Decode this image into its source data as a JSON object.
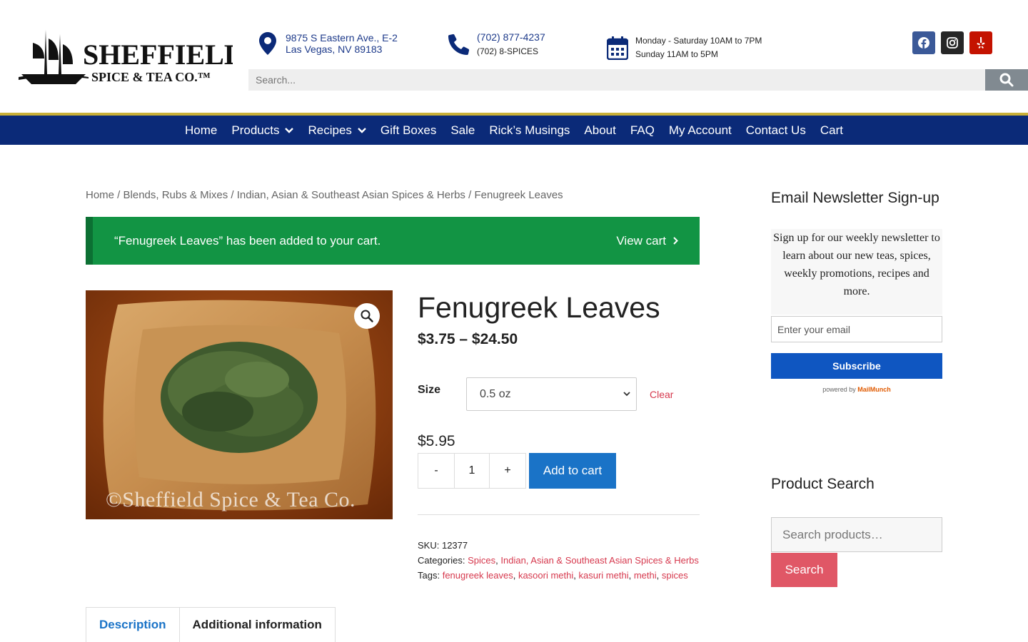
{
  "header": {
    "logo_text": "Sheffield Spice & Tea Co.",
    "address_line1": "9875 S Eastern Ave., E-2",
    "address_line2": "Las Vegas, NV 89183",
    "phone_line1": "(702) 877-4237",
    "phone_line2": "(702) 8-SPICES",
    "hours_line1": "Monday - Saturday 10AM to 7PM",
    "hours_line2": "Sunday 11AM to 5PM",
    "socials": [
      {
        "name": "facebook-icon",
        "color": "#3b5998"
      },
      {
        "name": "instagram-icon",
        "color": "#262626"
      },
      {
        "name": "yelp-icon",
        "color": "#c41200"
      }
    ],
    "search_placeholder": "Search..."
  },
  "nav": {
    "items": [
      "Home",
      "Products",
      "Recipes",
      "Gift Boxes",
      "Sale",
      "Rick’s Musings",
      "About",
      "FAQ",
      "My Account",
      "Contact Us",
      "Cart"
    ]
  },
  "breadcrumb": "Home / Blends, Rubs & Mixes / Indian, Asian & Southeast Asian Spices & Herbs / Fenugreek Leaves",
  "notice": {
    "message": "“Fenugreek Leaves” has been added to your cart.",
    "action": "View cart"
  },
  "product": {
    "image_watermark": "©Sheffield Spice & Tea Co.",
    "title": "Fenugreek Leaves",
    "price_range": "$3.75 – $24.50",
    "size_label": "Size",
    "size_value": "0.5 oz",
    "clear_label": "Clear",
    "variation_price": "$5.95",
    "qty_minus": "-",
    "qty_value": "1",
    "qty_plus": "+",
    "add_to_cart": "Add to cart",
    "sku_label": "SKU:",
    "sku": "12377",
    "categories_label": "Categories:",
    "categories": [
      "Spices",
      "Indian, Asian & Southeast Asian Spices & Herbs"
    ],
    "tags_label": "Tags:",
    "tags": [
      "fenugreek leaves",
      "kasoori methi",
      "kasuri methi",
      "methi",
      "spices"
    ]
  },
  "tabs": [
    "Description",
    "Additional information"
  ],
  "sidebar": {
    "newsletter_title": "Email Newsletter Sign-up",
    "newsletter_text": "Sign up for our weekly newsletter to learn about our new teas, spices, weekly promotions, recipes and more.",
    "email_placeholder": "Enter your email",
    "subscribe_label": "Subscribe",
    "powered_prefix": "powered by",
    "powered_brand": "MailMunch",
    "product_search_title": "Product Search",
    "product_search_placeholder": "Search products…",
    "product_search_button": "Search"
  },
  "colors": {
    "nav_bg": "#0b2a78",
    "notice_green": "#129444",
    "accent_link": "#d6384d",
    "add_to_cart_blue": "#1a73c7"
  }
}
